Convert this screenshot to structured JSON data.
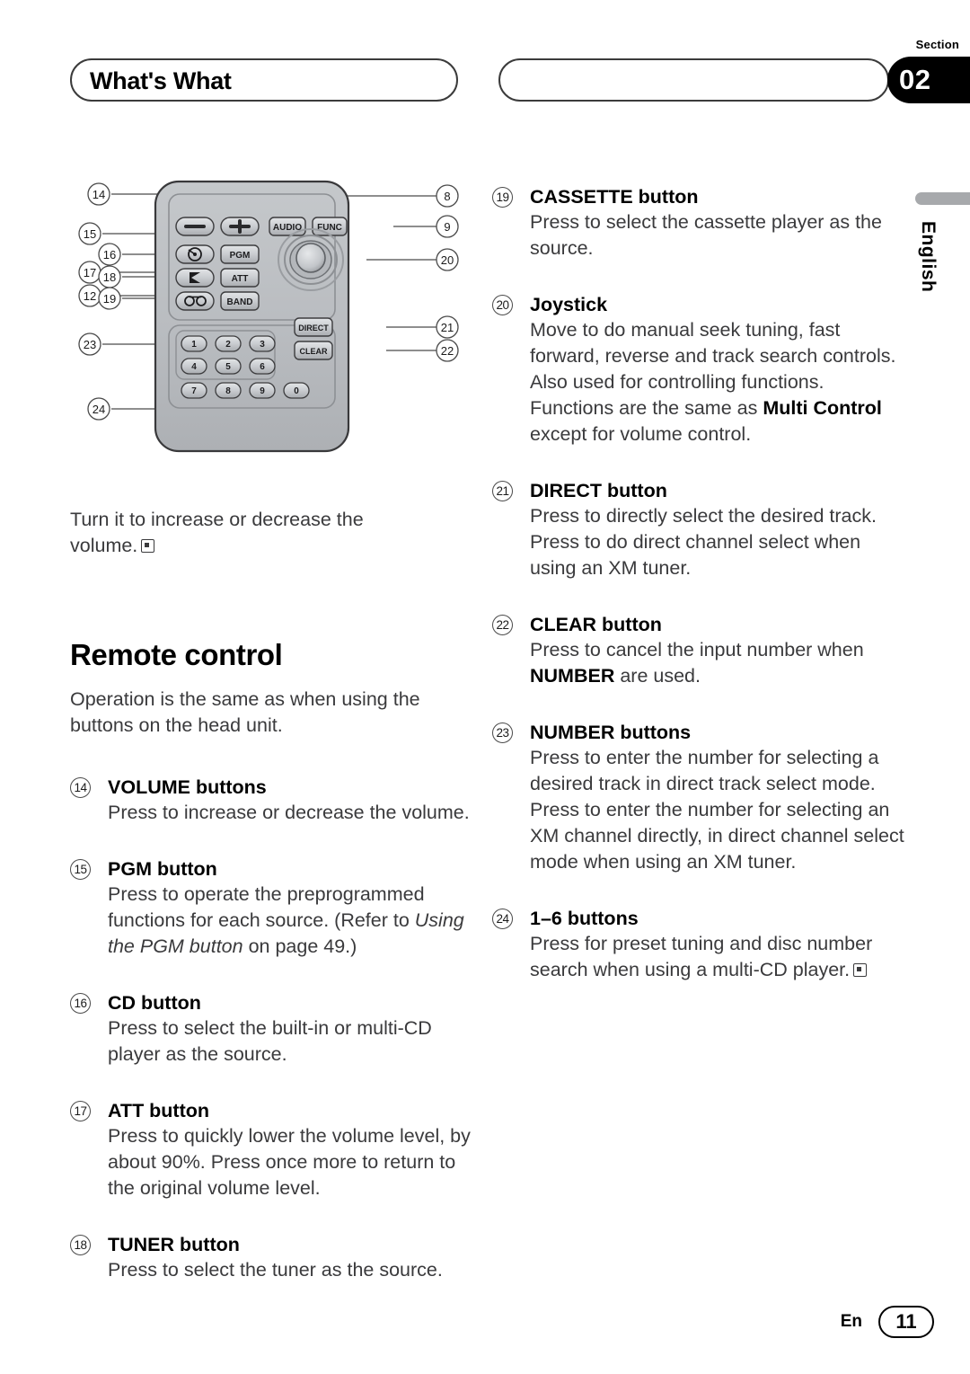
{
  "header": {
    "title": "What's What",
    "second_pill_text": "",
    "section_word": "Section",
    "section_number": "02"
  },
  "side_tab": {
    "language": "English"
  },
  "diagram": {
    "alt": "remote-control-diagram",
    "callouts": [
      {
        "id": "14",
        "side": "left"
      },
      {
        "id": "15",
        "side": "left"
      },
      {
        "id": "16",
        "side": "left"
      },
      {
        "id": "17",
        "side": "left"
      },
      {
        "id": "18",
        "side": "left"
      },
      {
        "id": "12",
        "side": "left"
      },
      {
        "id": "19",
        "side": "left"
      },
      {
        "id": "23",
        "side": "left"
      },
      {
        "id": "24",
        "side": "left"
      },
      {
        "id": "8",
        "side": "right"
      },
      {
        "id": "9",
        "side": "right"
      },
      {
        "id": "20",
        "side": "right"
      },
      {
        "id": "21",
        "side": "right"
      },
      {
        "id": "22",
        "side": "right"
      }
    ],
    "buttons": [
      {
        "label": "—",
        "name": "volume-down-button"
      },
      {
        "label": "+",
        "name": "volume-up-button"
      },
      {
        "label": "AUDIO",
        "name": "audio-button"
      },
      {
        "label": "FUNC",
        "name": "func-button"
      },
      {
        "label": "CD",
        "name": "cd-button"
      },
      {
        "label": "PGM",
        "name": "pgm-button"
      },
      {
        "label": "TUNER",
        "name": "tuner-button"
      },
      {
        "label": "ATT",
        "name": "att-button"
      },
      {
        "label": "CASSETTE",
        "name": "cassette-button"
      },
      {
        "label": "BAND",
        "name": "band-button"
      },
      {
        "label": "DIRECT",
        "name": "direct-button"
      },
      {
        "label": "CLEAR",
        "name": "clear-button"
      },
      {
        "label": "1",
        "name": "number-1-button"
      },
      {
        "label": "2",
        "name": "number-2-button"
      },
      {
        "label": "3",
        "name": "number-3-button"
      },
      {
        "label": "4",
        "name": "number-4-button"
      },
      {
        "label": "5",
        "name": "number-5-button"
      },
      {
        "label": "6",
        "name": "number-6-button"
      },
      {
        "label": "7",
        "name": "number-7-button"
      },
      {
        "label": "8",
        "name": "number-8-button"
      },
      {
        "label": "9",
        "name": "number-9-button"
      },
      {
        "label": "0",
        "name": "number-0-button"
      }
    ]
  },
  "left_column": {
    "intro_line1": "Turn it to increase or decrease the",
    "intro_line2": "volume.",
    "heading": "Remote control",
    "heading_body": "Operation is the same as when using the buttons on the head unit.",
    "entries": [
      {
        "num": "14",
        "title": "VOLUME buttons",
        "body_html": "Press to increase or decrease the volume."
      },
      {
        "num": "15",
        "title": "PGM button",
        "body_html": "Press to operate the preprogrammed functions for each source. (Refer to <i>Using the PGM button</i> on page 49.)"
      },
      {
        "num": "16",
        "title": "CD button",
        "body_html": "Press to select the built-in or multi-CD player as the source."
      },
      {
        "num": "17",
        "title": "ATT button",
        "body_html": "Press to quickly lower the volume level, by about 90%. Press once more to return to the original volume level."
      },
      {
        "num": "18",
        "title": "TUNER button",
        "body_html": "Press to select the tuner as the source."
      }
    ]
  },
  "right_column": {
    "entries": [
      {
        "num": "19",
        "title": "CASSETTE button",
        "body_html": "Press to select the cassette player as the source."
      },
      {
        "num": "20",
        "title": "Joystick",
        "body_html": "Move to do manual seek tuning, fast forward, reverse and track search controls. Also used for controlling functions. Functions are the same as <b>Multi Control</b> except for volume control."
      },
      {
        "num": "21",
        "title": "DIRECT button",
        "body_html": "Press to directly select the desired track. Press to do direct channel select when using an XM tuner."
      },
      {
        "num": "22",
        "title": "CLEAR button",
        "body_html": "Press to cancel the input number when <b>NUMBER</b> are used."
      },
      {
        "num": "23",
        "title": "NUMBER buttons",
        "body_html": "Press to enter the number for selecting a desired track in direct track select mode. Press to enter the number for selecting an XM channel directly, in direct channel select mode when using an XM tuner."
      },
      {
        "num": "24",
        "title": "1–6 buttons",
        "body_html": "Press for preset tuning and disc number search when using a multi-CD player."
      }
    ]
  },
  "footer": {
    "lang": "En",
    "page": "11"
  },
  "colors": {
    "text": "#3a3a3c",
    "heading": "#000000",
    "badge_bg": "#000000",
    "tab_gray": "#a7a9ac",
    "remote_body": "#b9bcc0"
  }
}
